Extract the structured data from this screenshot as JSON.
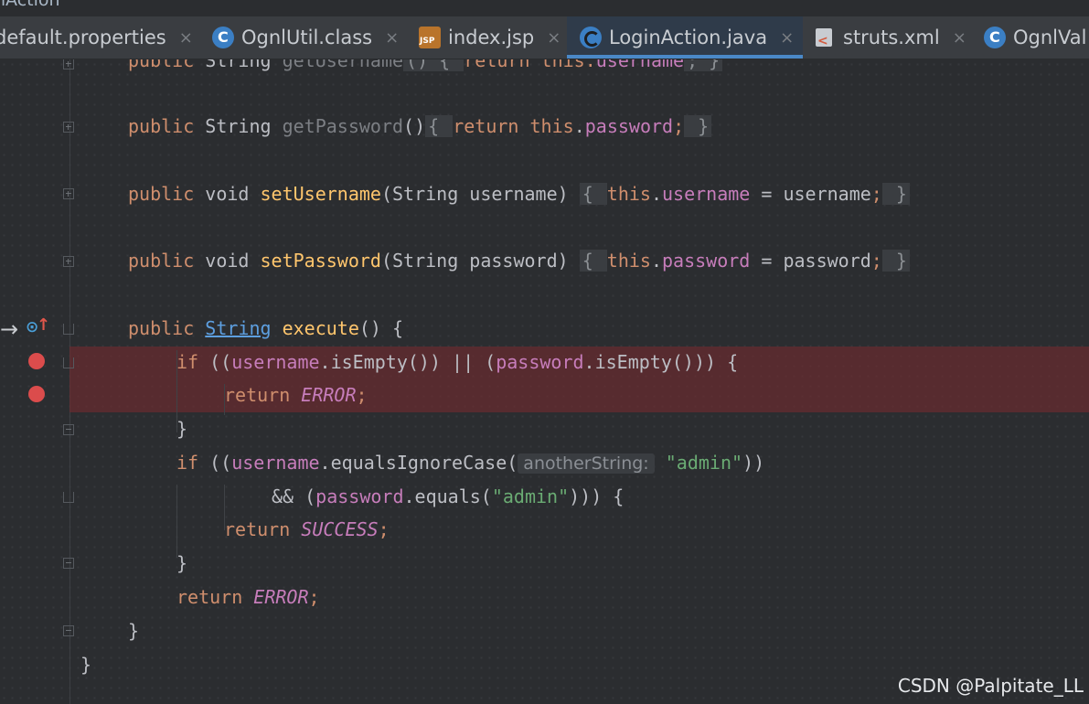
{
  "window": {
    "title": "nAction"
  },
  "tabs": [
    {
      "label": "default.properties",
      "icon": "properties-file-icon",
      "active": false
    },
    {
      "label": "OgnlUtil.class",
      "icon": "class-file-icon",
      "active": false
    },
    {
      "label": "index.jsp",
      "icon": "jsp-file-icon",
      "active": false
    },
    {
      "label": "LoginAction.java",
      "icon": "java-class-icon",
      "active": true
    },
    {
      "label": "struts.xml",
      "icon": "xml-file-icon",
      "active": false
    },
    {
      "label": "OgnlVal",
      "icon": "class-file-icon",
      "active": false
    }
  ],
  "close_glyph": "×",
  "code": {
    "l0": {
      "a": "public",
      "b": " String ",
      "c": "getUsername",
      "d": "() { ",
      "e": "return",
      "f": " this.",
      "g": "username",
      "h": "; }"
    },
    "l1": {
      "a": "public",
      "b": " String ",
      "c": "getPassword",
      "d": "()",
      "e": "{ ",
      "f": "return",
      "g": " this",
      "h": ".",
      "i": "password",
      "j": ";",
      "k": " }"
    },
    "l2": {
      "a": "public",
      "b": " void ",
      "c": "setUsername",
      "d": "(String username) ",
      "e": "{ ",
      "f": "this",
      "g": ".",
      "h": "username",
      "i": " = username",
      "j": ";",
      "k": " }"
    },
    "l3": {
      "a": "public",
      "b": " void ",
      "c": "setPassword",
      "d": "(String password) ",
      "e": "{ ",
      "f": "this",
      "g": ".",
      "h": "password",
      "i": " = password",
      "j": ";",
      "k": " }"
    },
    "l4": {
      "a": "public",
      "b": " ",
      "c": "String",
      "d": " ",
      "e": "execute",
      "f": "() {"
    },
    "l5": {
      "a": "if",
      "b": " ((",
      "c": "username",
      "d": ".isEmpty()) || (",
      "e": "password",
      "f": ".isEmpty())) {"
    },
    "l6": {
      "a": "return",
      "b": " ",
      "c": "ERROR",
      "d": ";"
    },
    "l7": {
      "a": "}"
    },
    "l8": {
      "a": "if",
      "b": " ((",
      "c": "username",
      "d": ".equalsIgnoreCase(",
      "e": "anotherString:",
      "f": "\"admin\"",
      "g": "))"
    },
    "l9": {
      "a": "&& (",
      "b": "password",
      "c": ".equals(",
      "d": "\"admin\"",
      "e": "))) {"
    },
    "l10": {
      "a": "return",
      "b": " ",
      "c": "SUCCESS",
      "d": ";"
    },
    "l11": {
      "a": "}"
    },
    "l12": {
      "a": "return",
      "b": " ",
      "c": "ERROR",
      "d": ";"
    },
    "l13": {
      "a": "}"
    },
    "l14": {
      "a": "}"
    }
  },
  "watermark": "CSDN @Palpitate_LL",
  "colors": {
    "editor_bg": "#2b2d30",
    "keyword": "#cf8e6d",
    "method": "#ffc66d",
    "field": "#c77dbb",
    "string": "#6aab73",
    "breakpoint": "#db4c4c",
    "breakpoint_line": "#732a2e",
    "active_tab_underline": "#4a88c7"
  }
}
